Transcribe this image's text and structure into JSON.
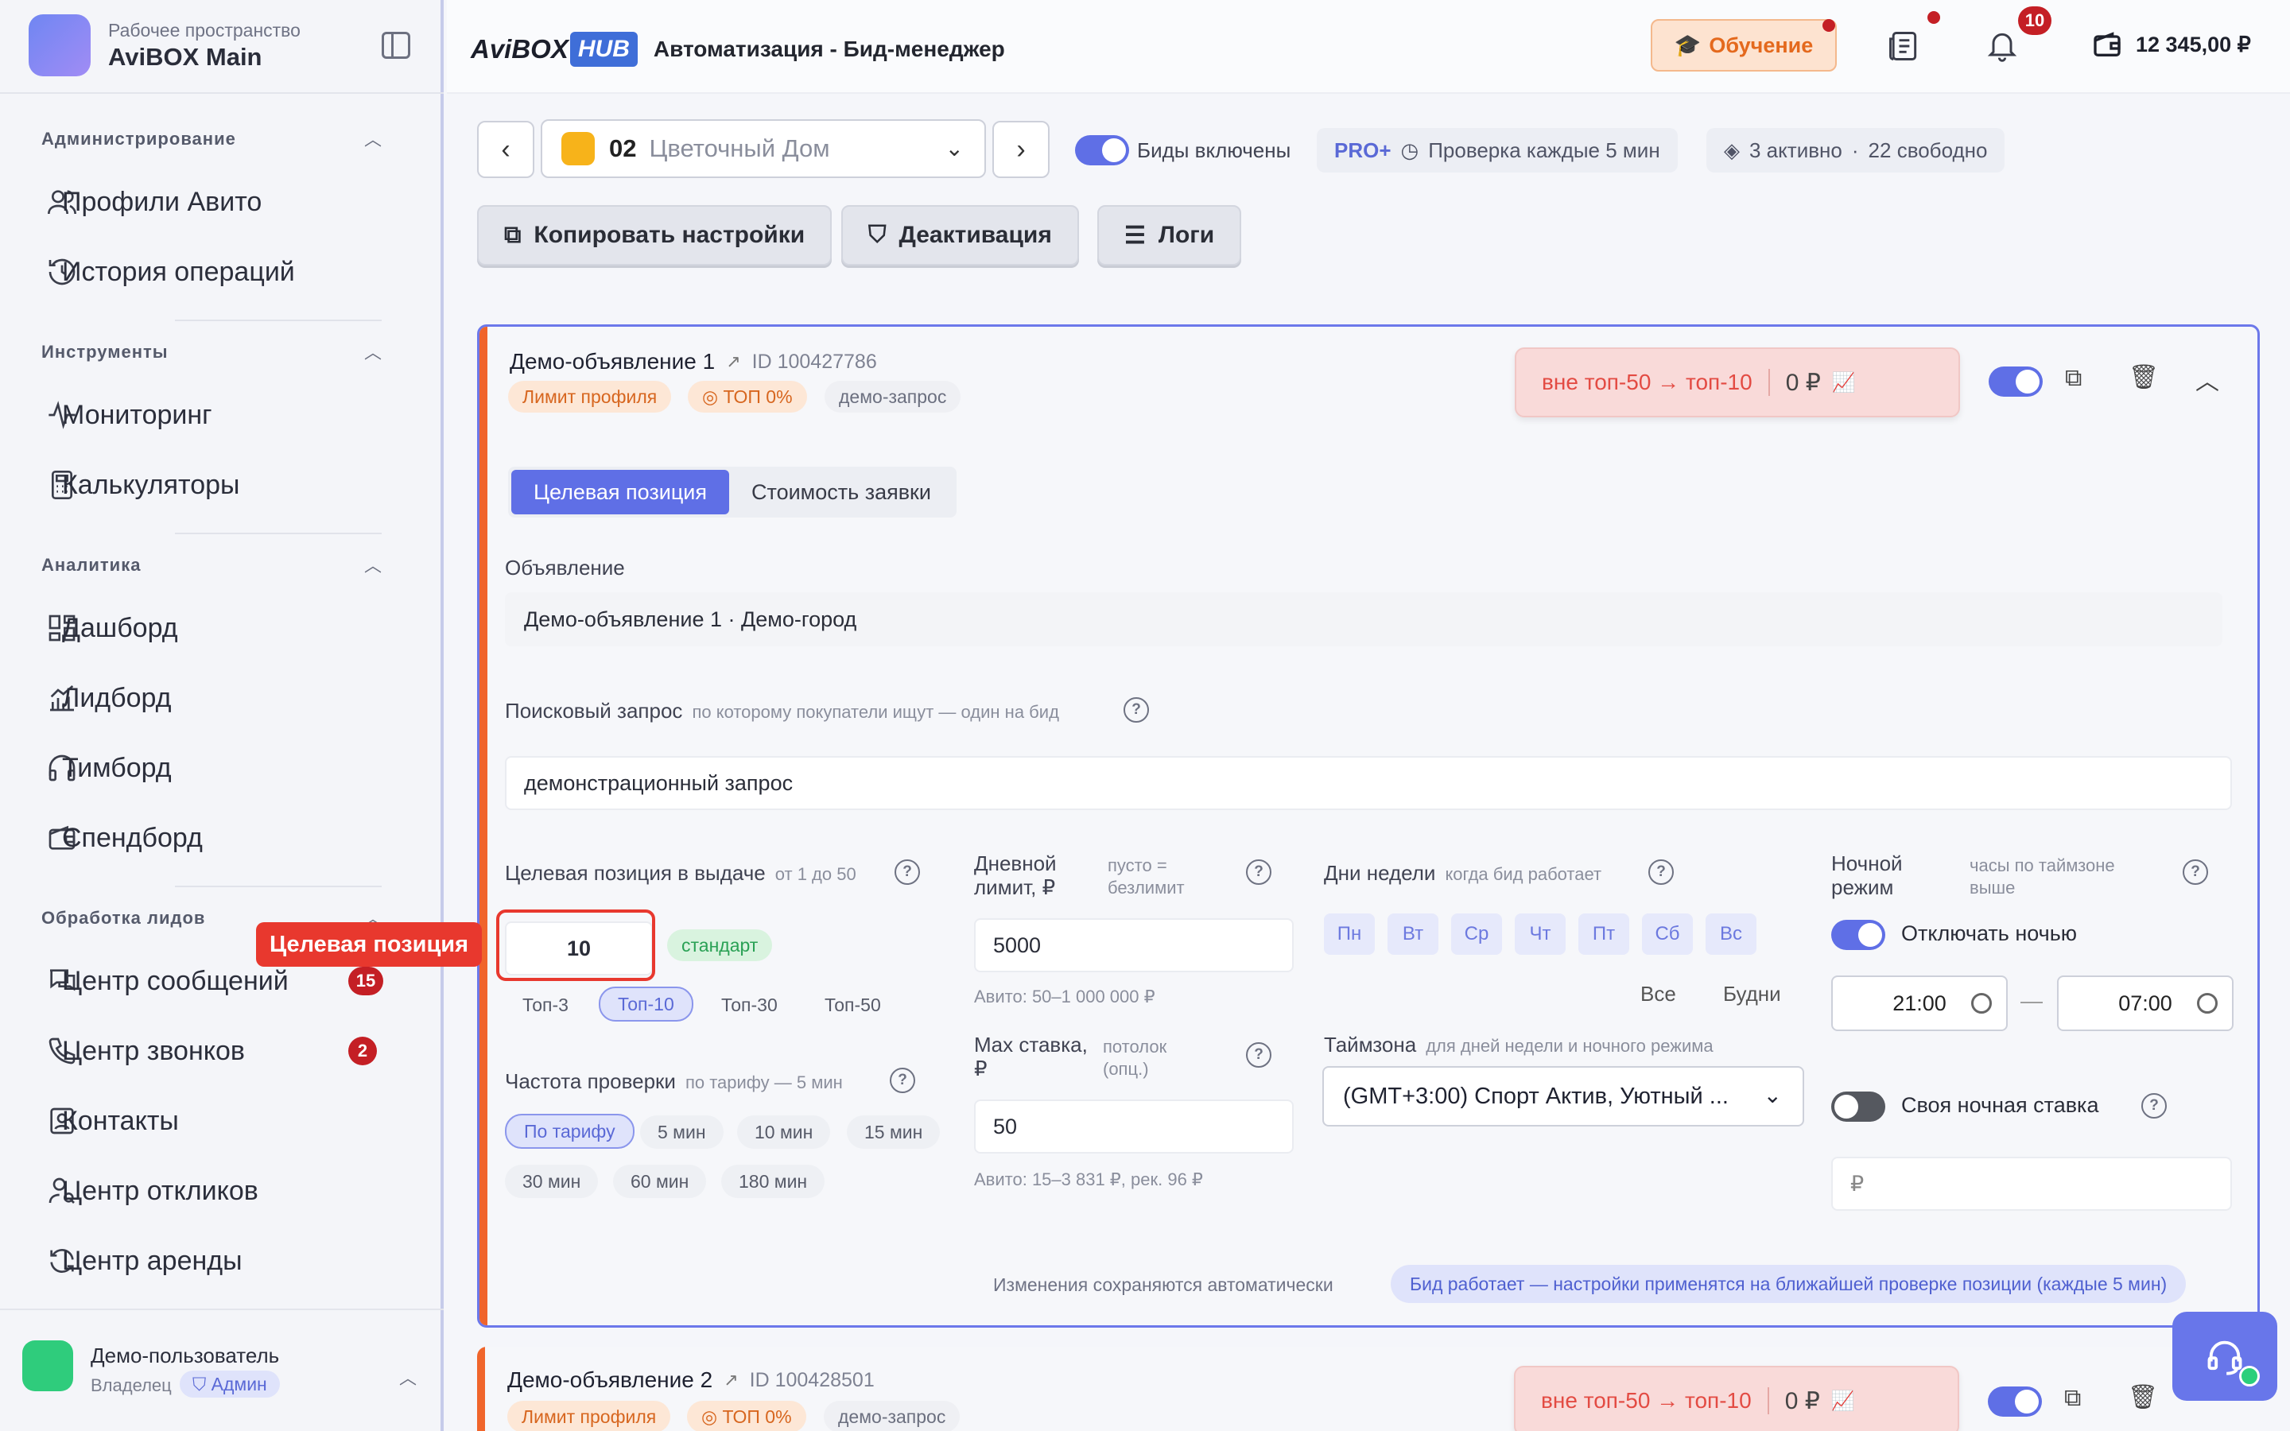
{
  "workspace": {
    "subtitle": "Рабочее пространство",
    "title": "AviBOX Main"
  },
  "sidebar": {
    "sections": [
      {
        "title": "Администрирование",
        "items": [
          {
            "label": "Профили Авито",
            "icon": "users-icon"
          },
          {
            "label": "История операций",
            "icon": "history-icon"
          }
        ]
      },
      {
        "title": "Инструменты",
        "items": [
          {
            "label": "Мониторинг",
            "icon": "activity-icon"
          },
          {
            "label": "Калькуляторы",
            "icon": "calculator-icon"
          }
        ]
      },
      {
        "title": "Аналитика",
        "items": [
          {
            "label": "Дашборд",
            "icon": "dashboard-icon"
          },
          {
            "label": "Лидборд",
            "icon": "chart-icon"
          },
          {
            "label": "Тимборд",
            "icon": "headphones-icon"
          },
          {
            "label": "Спендборд",
            "icon": "wallet-icon"
          }
        ]
      },
      {
        "title": "Обработка лидов",
        "items": [
          {
            "label": "Центр сообщений",
            "icon": "messages-icon",
            "badge": "15"
          },
          {
            "label": "Центр звонков",
            "icon": "phone-icon",
            "badge": "2"
          },
          {
            "label": "Контакты",
            "icon": "contact-icon"
          },
          {
            "label": "Центр откликов",
            "icon": "user-search-icon"
          },
          {
            "label": "Центр аренды",
            "icon": "refresh-icon"
          }
        ]
      }
    ]
  },
  "user": {
    "name": "Демо-пользователь",
    "role": "Владелец",
    "admin": "Админ"
  },
  "header": {
    "brand_a": "AviBOX",
    "brand_b": "HUB",
    "title": "Автоматизация - Бид-менеджер",
    "learn": "Обучение",
    "notif_count": "10",
    "balance": "12 345,00 ₽"
  },
  "toolbar": {
    "profile_num": "02",
    "profile_name": "Цветочный Дом",
    "bids_label": "Биды включены",
    "plan": "PRO+",
    "check": "Проверка каждые 5 мин",
    "active": "3 активно",
    "free": "22 свободно",
    "copy": "Копировать настройки",
    "deactivate": "Деактивация",
    "logs": "Логи"
  },
  "card": {
    "title": "Демо-объявление 1",
    "id": "ID 100427786",
    "chip_limit": "Лимит профиля",
    "chip_top": "ТОП 0%",
    "chip_query": "демо-запрос",
    "status": "вне топ-50 → топ-10",
    "status_amount": "0 ₽",
    "tab1": "Целевая позиция",
    "tab2": "Стоимость заявки",
    "ad_label": "Объявление",
    "ad_value": "Демо-объявление 1 · Демо-город",
    "query_label": "Поисковый запрос",
    "query_hint": "по которому покупатели ищут — один на бид",
    "query_value": "демонстрационный запрос",
    "pos_label": "Целевая позиция в выдаче",
    "pos_hint": "от 1 до 50",
    "pos_value": "10",
    "pos_tag": "стандарт",
    "pos_opts": [
      "Топ-3",
      "Топ-10",
      "Топ-30",
      "Топ-50"
    ],
    "freq_label": "Частота проверки",
    "freq_hint": "по тарифу — 5 мин",
    "freq_opts": [
      "По тарифу",
      "5 мин",
      "10 мин",
      "15 мин",
      "30 мин",
      "60 мин",
      "180 мин"
    ],
    "daily_label1": "Дневной",
    "daily_label2": "лимит, ₽",
    "daily_hint1": "пусто =",
    "daily_hint2": "безлимит",
    "daily_value": "5000",
    "daily_sub": "Авито: 50–1 000 000 ₽",
    "max_label1": "Max ставка,",
    "max_label2": "₽",
    "max_hint1": "потолок",
    "max_hint2": "(опц.)",
    "max_value": "50",
    "max_sub": "Авито: 15–3 831 ₽, рек. 96 ₽",
    "days_label": "Дни недели",
    "days_hint": "когда бид работает",
    "days": [
      "Пн",
      "Вт",
      "Ср",
      "Чт",
      "Пт",
      "Сб",
      "Вс"
    ],
    "all": "Все",
    "weekdays": "Будни",
    "tz_label": "Таймзона",
    "tz_hint": "для дней недели и ночного режима",
    "tz_value": "(GMT+3:00) Спорт Актив, Уютный ...",
    "night_label1": "Ночной",
    "night_label2": "режим",
    "night_hint1": "часы по таймзоне",
    "night_hint2": "выше",
    "night_toggle": "Отключать ночью",
    "time_from": "21:00",
    "time_dash": "—",
    "time_to": "07:00",
    "night_bid": "Своя ночная ставка",
    "night_bid_placeholder": "₽",
    "autosave": "Изменения сохраняются автоматически",
    "info": "Бид работает — настройки применятся на ближайшей проверке позиции (каждые 5 мин)"
  },
  "card2": {
    "title": "Демо-объявление 2",
    "id": "ID 100428501",
    "chip_limit": "Лимит профиля",
    "chip_top": "ТОП 0%",
    "chip_query": "демо-запрос",
    "status": "вне топ-50 → топ-10",
    "status_amount": "0 ₽"
  },
  "tooltip": "Целевая позиция",
  "colors": {
    "accent": "#5f6fe6",
    "orange": "#f0652b",
    "danger": "#e8382e"
  }
}
